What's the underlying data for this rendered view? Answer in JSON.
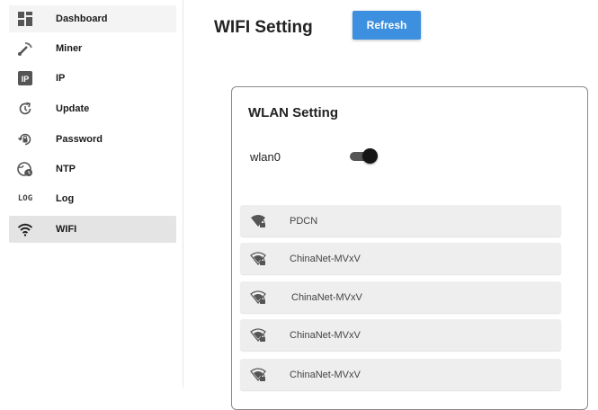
{
  "sidebar": {
    "items": [
      {
        "label": "Dashboard",
        "icon": "dashboard-icon"
      },
      {
        "label": "Miner",
        "icon": "miner-icon"
      },
      {
        "label": "IP",
        "icon": "ip-icon",
        "icon_text": "IP"
      },
      {
        "label": "Update",
        "icon": "update-icon"
      },
      {
        "label": "Password",
        "icon": "password-icon"
      },
      {
        "label": "NTP",
        "icon": "ntp-icon"
      },
      {
        "label": "Log",
        "icon": "log-icon",
        "icon_text": "LOG"
      },
      {
        "label": "WIFI",
        "icon": "wifi-icon"
      }
    ],
    "active": "WIFI"
  },
  "header": {
    "title": "WIFI Setting",
    "refresh_label": "Refresh",
    "accent": "#3d8fe0"
  },
  "wlan": {
    "title": "WLAN Setting",
    "interface": "wlan0",
    "enabled": true,
    "networks": [
      {
        "ssid": "PDCN"
      },
      {
        "ssid": "ChinaNet-MVxV"
      },
      {
        "ssid": "ChinaNet-MVxV"
      },
      {
        "ssid": "ChinaNet-MVxV"
      },
      {
        "ssid": "ChinaNet-MVxV"
      }
    ]
  }
}
